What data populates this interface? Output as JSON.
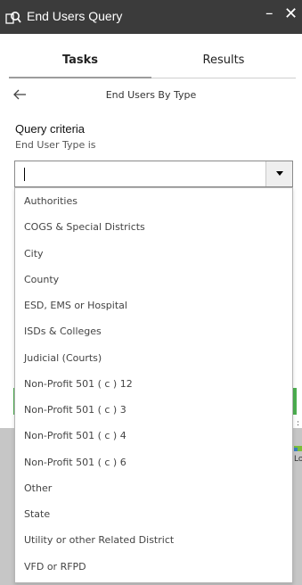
{
  "window": {
    "title": "End Users Query",
    "minimize_label": "–",
    "close_label": "✕",
    "icon": "query-search-icon"
  },
  "tabs": [
    {
      "label": "Tasks",
      "active": true
    },
    {
      "label": "Results",
      "active": false
    }
  ],
  "task": {
    "back_icon": "back-arrow-icon",
    "heading": "End Users By Type"
  },
  "criteria": {
    "title": "Query criteria",
    "label": "End User Type is",
    "input_value": "",
    "dropdown_icon": "caret-down-icon"
  },
  "dropdown": {
    "options": [
      "Authorities",
      "COGS & Special Districts",
      "City",
      "County",
      "ESD, EMS or Hospital",
      "ISDs & Colleges",
      "Judicial (Courts)",
      "Non-Profit 501 ( c ) 12",
      "Non-Profit 501 ( c ) 3",
      "Non-Profit 501 ( c ) 4",
      "Non-Profit 501 ( c ) 6",
      "Other",
      "State",
      "Utility or other Related District",
      "VFD or RFPD"
    ]
  },
  "background": {
    "map_fragment": "Lo",
    "dots": ":"
  },
  "colors": {
    "titlebar": "#3b3b3b",
    "accent_green": "#4caf50",
    "map_gray": "#c6c6c6"
  }
}
